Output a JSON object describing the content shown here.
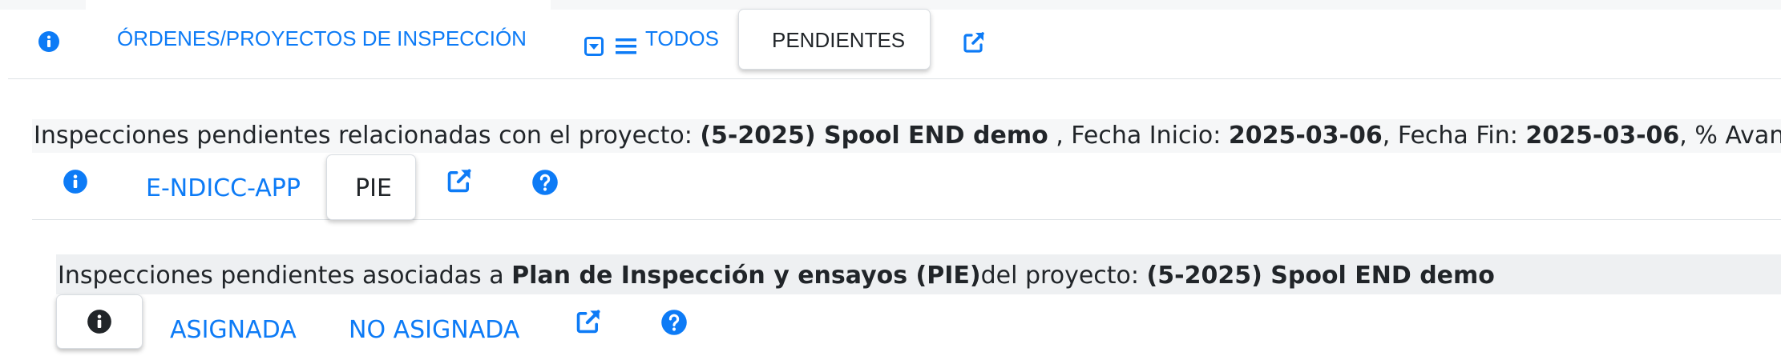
{
  "top_tabs": {
    "inspection_orders": "ÓRDENES/PROYECTOS DE INSPECCIÓN",
    "all": "TODOS",
    "pending": "PENDIENTES"
  },
  "project_summary": {
    "prefix": "Inspecciones pendientes relacionadas con el proyecto: ",
    "project": "(5-2025) Spool END demo",
    "start_label": " , Fecha Inicio: ",
    "start_date": "2025-03-06",
    "end_label": ", Fecha Fin: ",
    "end_date": "2025-03-06",
    "progress_label": ", % Avance: ",
    "progress_value": "%"
  },
  "sub_tabs": {
    "endicc": "E-NDICC-APP",
    "pie": "PIE"
  },
  "pie_summary": {
    "prefix": "Inspecciones pendientes asociadas a ",
    "plan": "Plan de Inspección y ensayos (PIE)",
    "middle": "del proyecto: ",
    "project": "(5-2025) Spool END demo"
  },
  "assign_tabs": {
    "assigned": "ASIGNADA",
    "not_assigned": "NO ASIGNADA"
  },
  "icons": {
    "info": "info-circle-icon",
    "dropdown": "caret-square-down-icon",
    "list": "bars-icon",
    "external": "external-link-icon",
    "help": "question-circle-icon"
  },
  "colors": {
    "accent": "#0d7bf6",
    "text": "#212529",
    "dark_icon": "#212529"
  }
}
